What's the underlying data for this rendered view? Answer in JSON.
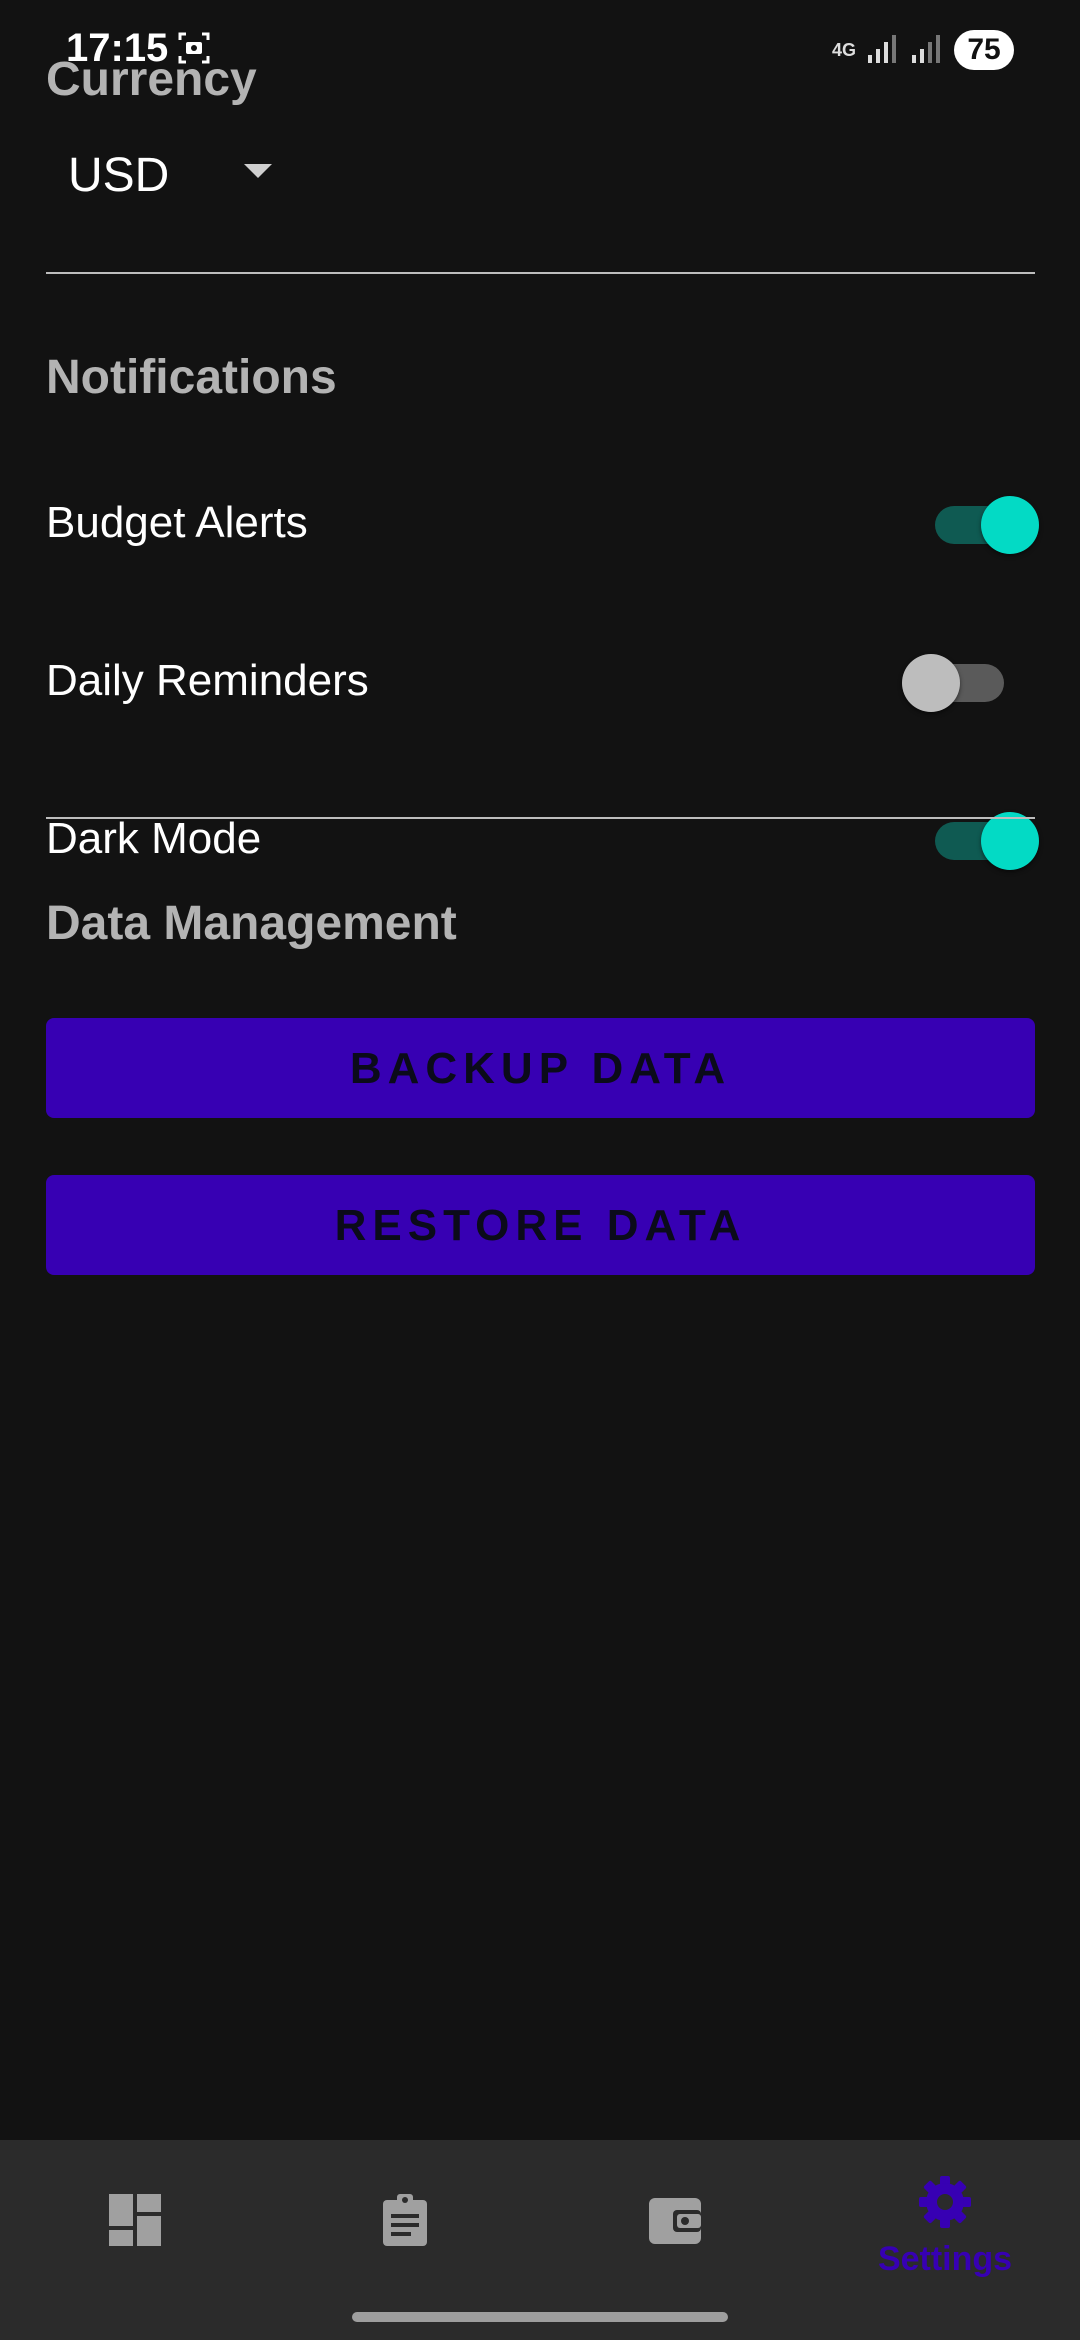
{
  "status_bar": {
    "time": "17:15",
    "network": "4G",
    "battery": "75"
  },
  "settings": {
    "currency": {
      "title": "Currency",
      "value": "USD"
    },
    "notifications": {
      "title": "Notifications",
      "items": [
        {
          "label": "Budget Alerts",
          "enabled": true
        },
        {
          "label": "Daily Reminders",
          "enabled": false
        },
        {
          "label": "Dark Mode",
          "enabled": true
        }
      ]
    },
    "data_management": {
      "title": "Data Management",
      "backup_label": "BACKUP DATA",
      "restore_label": "RESTORE DATA"
    }
  },
  "bottom_nav": {
    "items": [
      {
        "icon": "dashboard-icon"
      },
      {
        "icon": "clipboard-icon"
      },
      {
        "icon": "wallet-icon"
      },
      {
        "icon": "gear-icon",
        "label": "Settings",
        "active": true
      }
    ]
  },
  "colors": {
    "background": "#121212",
    "accent": "#3700b3",
    "toggle_on": "#03dac5",
    "section_title": "#b3b3b3"
  }
}
